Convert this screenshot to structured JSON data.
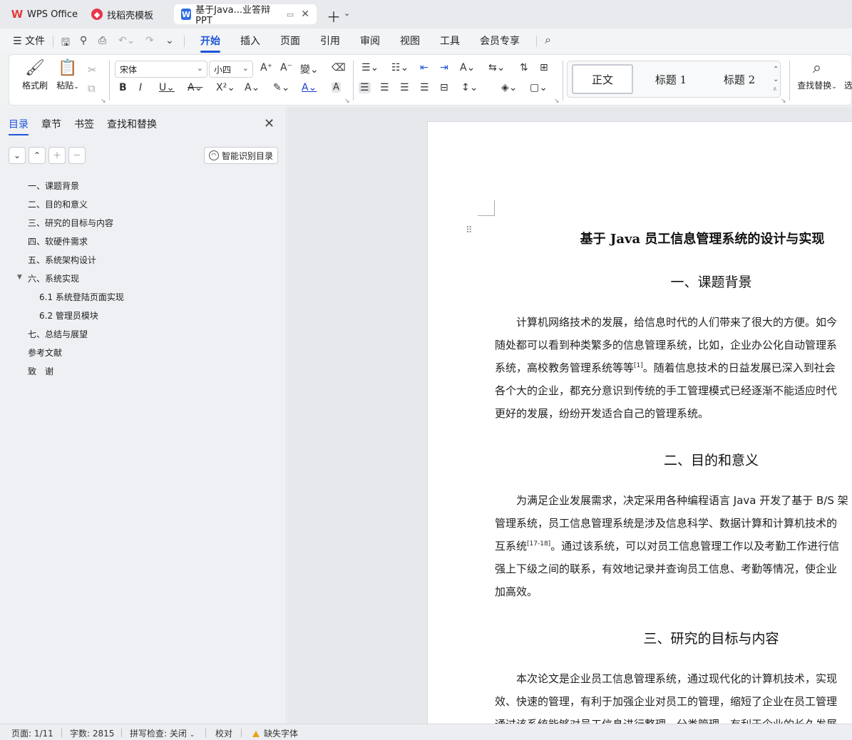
{
  "tabs": [
    {
      "label": "WPS Office",
      "icon": "wps-logo-icon",
      "color": "#e23b3b"
    },
    {
      "label": "找稻壳模板",
      "icon": "docer-icon",
      "color": "#e8344c"
    },
    {
      "label": "基于Java...业答辩PPT",
      "icon": "word-doc-icon",
      "color": "#2f6de1"
    }
  ],
  "menu": {
    "file": "文件",
    "items": [
      "开始",
      "插入",
      "页面",
      "引用",
      "审阅",
      "视图",
      "工具",
      "会员专享"
    ],
    "active": "开始"
  },
  "ribbon": {
    "format_painter": "格式刷",
    "paste": "粘贴",
    "font_name": "宋体",
    "font_size": "小四",
    "styles": [
      "正文",
      "标题 1",
      "标题 2"
    ],
    "find_replace": "查找替换",
    "select": "选"
  },
  "nav": {
    "tabs": [
      "目录",
      "章节",
      "书签",
      "查找和替换"
    ],
    "active_tab": "目录",
    "smart_toc": "智能识别目录",
    "toc": [
      {
        "label": "一、课题背景",
        "level": 1
      },
      {
        "label": "二、目的和意义",
        "level": 1
      },
      {
        "label": "三、研究的目标与内容",
        "level": 1
      },
      {
        "label": "四、软硬件需求",
        "level": 1
      },
      {
        "label": "五、系统架构设计",
        "level": 1
      },
      {
        "label": "六、系统实现",
        "level": 1,
        "expanded": true
      },
      {
        "label": "6.1 系统登陆页面实现",
        "level": 2
      },
      {
        "label": "6.2 管理员模块",
        "level": 2
      },
      {
        "label": "七、总结与展望",
        "level": 1
      },
      {
        "label": "参考文献",
        "level": 1
      },
      {
        "label": "致　谢",
        "level": 1
      }
    ]
  },
  "document": {
    "title": "基于 Java 员工信息管理系统的设计与实现",
    "sections": [
      {
        "heading": "一、课题背景",
        "lines": [
          "　　计算机网络技术的发展，给信息时代的人们带来了很大的方便。如今",
          "随处都可以看到种类繁多的信息管理系统，比如，企业办公化自动管理系",
          "系统，高校教务管理系统等等",
          "。随着信息技术的日益发展已深入到社会",
          "各个大的企业，都充分意识到传统的手工管理模式已经逐渐不能适应时代",
          "更好的发展，纷纷开发适合自己的管理系统。"
        ],
        "cite": "[1]"
      },
      {
        "heading": "二、目的和意义",
        "lines": [
          "　　为满足企业发展需求，决定采用各种编程语言 Java 开发了基于 B/S 架",
          "管理系统，员工信息管理系统是涉及信息科学、数据计算和计算机技术的",
          "互系统",
          "。通过该系统，可以对员工信息管理工作以及考勤工作进行信",
          "强上下级之间的联系，有效地记录并查询员工信息、考勤等情况，使企业",
          "加高效。"
        ],
        "cite": "[17-18]"
      },
      {
        "heading": "三、研究的目标与内容",
        "lines": [
          "　　本次论文是企业员工信息管理系统，通过现代化的计算机技术，实现",
          "效、快速的管理，有利于加强企业对员工的管理，缩短了企业在员工管理",
          "通过该系统能够对员工信息进行整理、分类管理，有利于企业的长久发展"
        ]
      }
    ]
  },
  "status": {
    "page": "页面: 1/11",
    "words": "字数: 2815",
    "spell": "拼写检查: 关闭",
    "proof": "校对",
    "missing_font": "缺失字体"
  },
  "colors": {
    "accent": "#1e55d6",
    "warning": "#e8a317"
  }
}
